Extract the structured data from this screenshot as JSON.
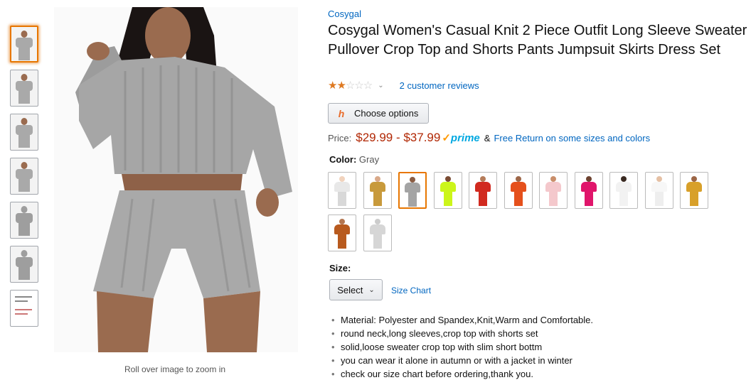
{
  "gallery": {
    "thumbnails": [
      {
        "kind": "model-front",
        "color": "#a9a9a9",
        "skin": "#9a6b4f"
      },
      {
        "kind": "model-side",
        "color": "#a9a9a9",
        "skin": "#9a6b4f"
      },
      {
        "kind": "model-pose",
        "color": "#a9a9a9",
        "skin": "#9a6b4f"
      },
      {
        "kind": "model-full",
        "color": "#a9a9a9",
        "skin": "#9a6b4f"
      },
      {
        "kind": "flat-top",
        "color": "#9e9e9e",
        "skin": "#9e9e9e"
      },
      {
        "kind": "flat-set",
        "color": "#9e9e9e",
        "skin": "#9e9e9e"
      },
      {
        "kind": "size-chart-doc",
        "color": "#c77",
        "skin": "#fff"
      }
    ],
    "zoom_hint": "Roll over image to zoom in"
  },
  "product": {
    "brand": "Cosygal",
    "title": "Cosygal Women's Casual Knit 2 Piece Outfit Long Sleeve Sweater Pullover Crop Top and Shorts Pants Jumpsuit Skirts Dress Set",
    "rating": {
      "filled_stars": "★★",
      "empty_stars": "☆☆☆",
      "chevron": "⌄",
      "reviews_link": "2 customer reviews"
    },
    "choose_options": {
      "icon": "h",
      "label": "Choose options"
    },
    "price": {
      "label": "Price:",
      "value": "$29.99 - $37.99",
      "prime_check": "✓",
      "prime": "prime",
      "amp": "&",
      "free_return": "Free Return on some sizes and colors"
    },
    "color": {
      "label": "Color:",
      "selected": "Gray",
      "swatches": [
        {
          "top": "#e8e8e8",
          "bottom": "#d8d8d8",
          "skin": "#f1d3bd"
        },
        {
          "top": "#c89a3c",
          "bottom": "#c89a3c",
          "skin": "#d9a989"
        },
        {
          "top": "#a4a4a4",
          "bottom": "#a4a4a4",
          "skin": "#8a5c43",
          "selected": true
        },
        {
          "top": "#ccf51a",
          "bottom": "#ccf51a",
          "skin": "#7a4b33"
        },
        {
          "top": "#d12a1f",
          "bottom": "#d12a1f",
          "skin": "#b57c5a"
        },
        {
          "top": "#e5501c",
          "bottom": "#e5501c",
          "skin": "#9d6648"
        },
        {
          "top": "#f4c8cc",
          "bottom": "#f4c8cc",
          "skin": "#c98e6a"
        },
        {
          "top": "#e0156b",
          "bottom": "#e0156b",
          "skin": "#6d4230"
        },
        {
          "top": "#f2f2f2",
          "bottom": "#f2f2f2",
          "skin": "#3a2a22"
        },
        {
          "top": "#f7f7f7",
          "bottom": "#eeeeee",
          "skin": "#e5c0a4"
        },
        {
          "top": "#d8a02a",
          "bottom": "#d8a02a",
          "skin": "#9b6546"
        },
        {
          "top": "#b85a1e",
          "bottom": "#b85a1e",
          "skin": "#b47650"
        },
        {
          "top": "#d6d6d6",
          "bottom": "#d6d6d6",
          "skin": "#cccccc"
        }
      ]
    },
    "size": {
      "label": "Size:",
      "select_value": "Select",
      "caret": "⌄",
      "size_chart_link": "Size Chart"
    },
    "bullets": [
      "Material: Polyester and Spandex,Knit,Warm and Comfortable.",
      "round neck,long sleeves,crop top with shorts set",
      "solid,loose sweater crop top with slim short bottm",
      "you can wear it alone in autumn or with a jacket in winter",
      "check our size chart before ordering,thank you."
    ]
  }
}
